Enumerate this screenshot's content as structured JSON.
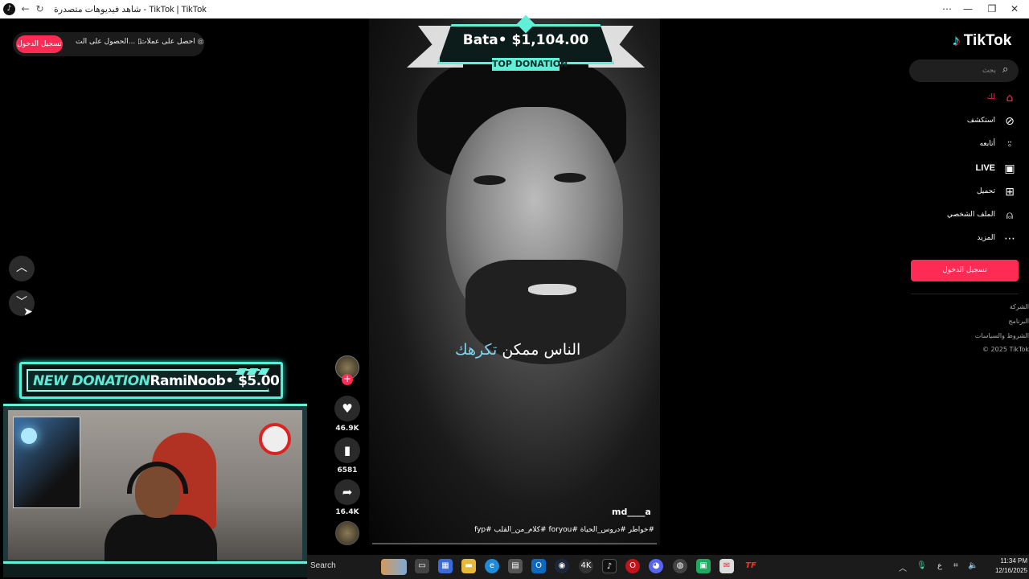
{
  "browser": {
    "title": "شاهد فيديوهات متصدرة - TikTok | TikTok",
    "logo_icon": "tiktok-favicon-icon",
    "back_icon": "back-arrow-icon",
    "reload_icon": "reload-icon",
    "more_icon": "more-icon",
    "minimize_icon": "minimize-icon",
    "maximize_icon": "maximize-icon",
    "close_icon": "close-icon"
  },
  "top_actions": {
    "login_label": "تسجيل الدخول",
    "get_app_label": "الحصول على الت...",
    "get_coins_label": "احصل على عملات"
  },
  "overlay": {
    "top_donation_amount": "Bata• $1,104.00",
    "top_donation_label": "TOP DONATION",
    "new_donation_label": "NEW DONATION",
    "new_donation_text": "RamiNoob• $5.00",
    "accent_color": "#5ff0d8"
  },
  "video": {
    "caption_part1": "الناس ممكن",
    "caption_part2": "تكرهك",
    "author": "md____a",
    "description": "#خواطر #دروس_الحياة #foryou #كلام_من_القلب #fyp",
    "like_count": "46.9K",
    "save_count": "6581",
    "share_count": "16.4K"
  },
  "sidebar": {
    "brand": "TikTok",
    "search_placeholder": "بحث",
    "items": [
      {
        "label": "لك",
        "icon": "home-icon"
      },
      {
        "label": "استكشف",
        "icon": "compass-icon"
      },
      {
        "label": "أتابعه",
        "icon": "following-icon"
      },
      {
        "label": "LIVE",
        "icon": "live-icon"
      },
      {
        "label": "تحميل",
        "icon": "upload-icon"
      },
      {
        "label": "الملف الشخصي",
        "icon": "profile-icon"
      },
      {
        "label": "المزيد",
        "icon": "more-dots-icon"
      }
    ],
    "login_button": "تسجيل الدخول",
    "footer": [
      "الشركة",
      "البرنامج",
      "الشروط والسياسات",
      "© 2025 TikTok"
    ],
    "brand_color": "#fe2c55"
  },
  "taskbar": {
    "search_label": "Search",
    "tray_lang": "ع",
    "time": "11:34 PM",
    "date": "12/16/2025"
  }
}
